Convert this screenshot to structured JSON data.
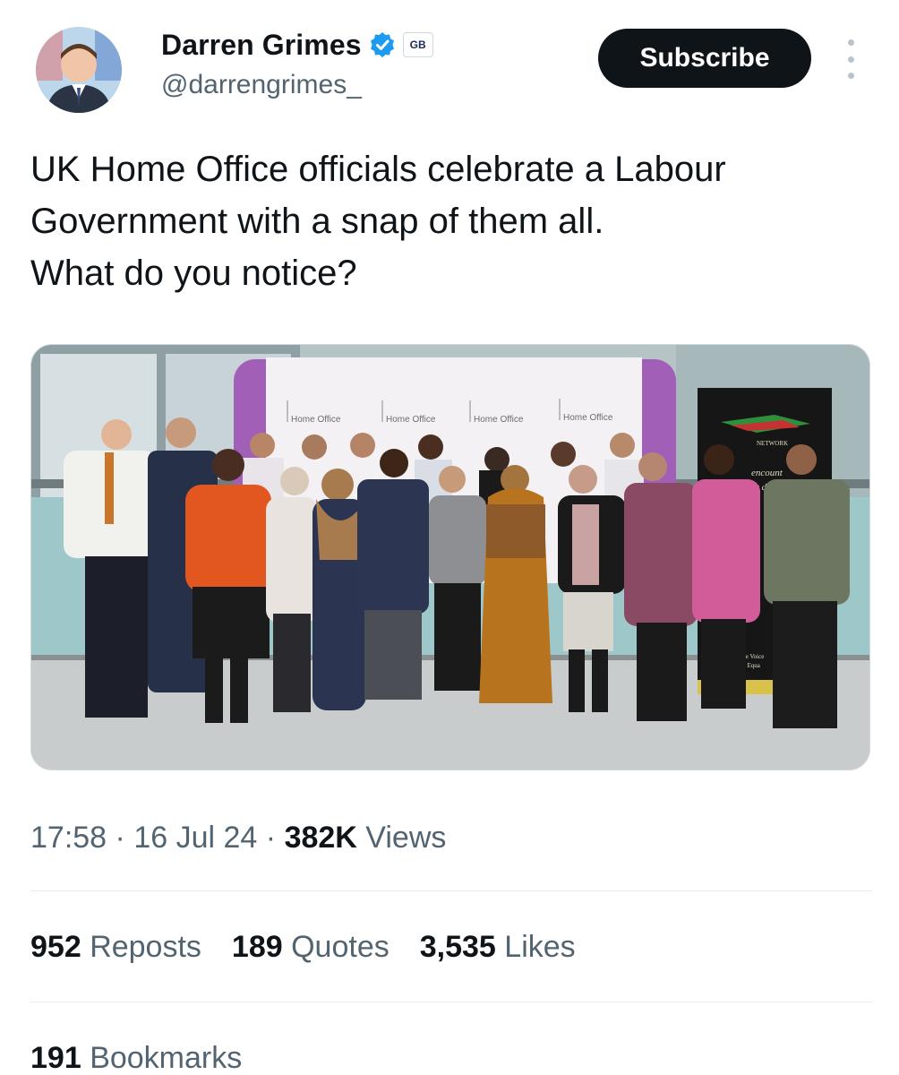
{
  "author": {
    "name": "Darren Grimes",
    "handle": "@darrengrimes_",
    "affiliate_badge": "GB",
    "verified_color": "#1d9bf0"
  },
  "header": {
    "subscribe_label": "Subscribe"
  },
  "tweet": {
    "lines": [
      "UK Home Office officials celebrate a Labour",
      "Government with a snap of them all.",
      "What do you notice?"
    ]
  },
  "photo": {
    "banner_labels": [
      "Home Office",
      "Home Office",
      "Home Office",
      "Home Office"
    ],
    "standee_text": [
      "NETWORK",
      "encount",
      "y def",
      "The Voice",
      "nce Equa"
    ]
  },
  "meta": {
    "time": "17:58",
    "date": "16 Jul 24",
    "views_count": "382K",
    "views_label": "Views",
    "separator": "·"
  },
  "engagement": {
    "reposts_count": "952",
    "reposts_label": "Reposts",
    "quotes_count": "189",
    "quotes_label": "Quotes",
    "likes_count": "3,535",
    "likes_label": "Likes",
    "bookmarks_count": "191",
    "bookmarks_label": "Bookmarks"
  },
  "colors": {
    "text_primary": "#0f1419",
    "text_secondary": "#536471",
    "button_bg": "#0f1419",
    "accent_purple": "#9b59b6"
  }
}
